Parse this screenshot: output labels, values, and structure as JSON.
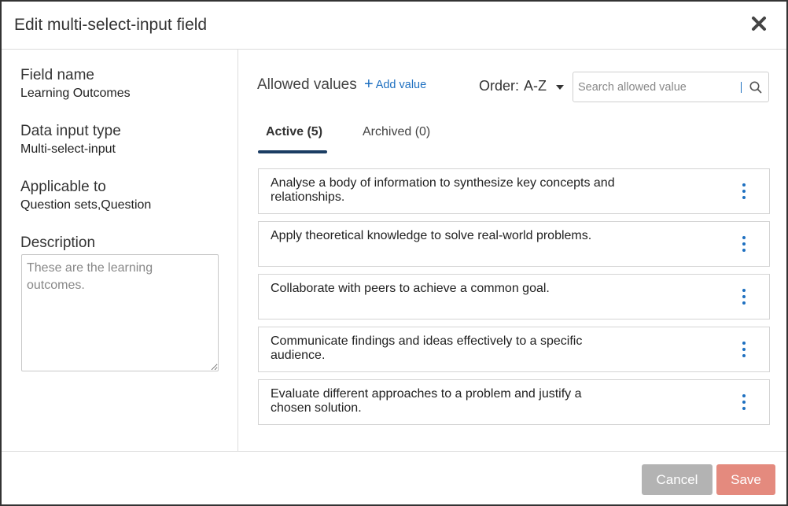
{
  "dialog": {
    "title": "Edit multi-select-input field"
  },
  "left": {
    "field_name_label": "Field name",
    "field_name_value": "Learning Outcomes",
    "input_type_label": "Data input type",
    "input_type_value": "Multi-select-input",
    "applicable_label": "Applicable to",
    "applicable_value": "Question sets,Question",
    "description_label": "Description",
    "description_value": "These are the learning outcomes."
  },
  "right": {
    "allowed_values_label": "Allowed values",
    "add_value_label": "Add value",
    "order_label": "Order:",
    "order_value": "A-Z",
    "search_placeholder": "Search allowed value",
    "tabs": [
      {
        "label": "Active (5)",
        "active": true
      },
      {
        "label": "Archived (0)",
        "active": false
      }
    ],
    "values": [
      "Analyse a body of information to synthesize key concepts and relationships.",
      "Apply theoretical knowledge to solve real-world problems.",
      "Collaborate with peers to achieve a common goal.",
      "Communicate findings and ideas effectively to a specific audience.",
      "Evaluate different approaches to a problem and justify a chosen solution."
    ]
  },
  "footer": {
    "cancel_label": "Cancel",
    "save_label": "Save"
  },
  "colors": {
    "accent": "#1d6fc0",
    "tab_underline": "#1b3d63",
    "save_button": "#e48a7e",
    "cancel_button": "#b3b3b3"
  },
  "icons": {
    "close": "close-icon",
    "search": "search-icon",
    "add": "plus-icon",
    "order": "caret-down-icon",
    "menu": "kebab-menu-icon"
  }
}
